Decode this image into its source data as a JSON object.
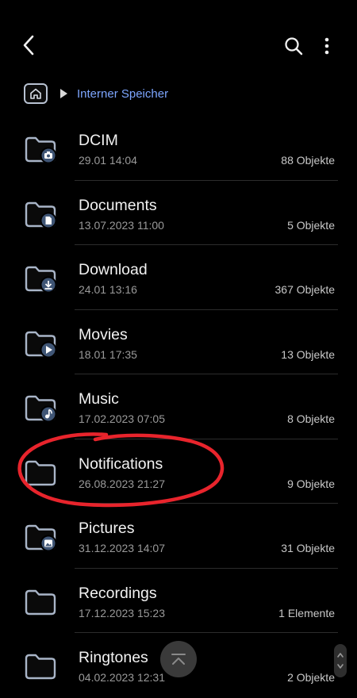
{
  "toolbar": {
    "back_icon": "chevron-left-icon",
    "search_icon": "search-icon",
    "more_icon": "more-vertical-icon"
  },
  "breadcrumb": {
    "home_icon": "home-icon",
    "label": "Interner Speicher",
    "accent": "#7da6ff"
  },
  "folders": [
    {
      "name": "DCIM",
      "date": "29.01 14:04",
      "count": "88 Objekte",
      "badge": "camera"
    },
    {
      "name": "Documents",
      "date": "13.07.2023 11:00",
      "count": "5 Objekte",
      "badge": "document"
    },
    {
      "name": "Download",
      "date": "24.01 13:16",
      "count": "367 Objekte",
      "badge": "download"
    },
    {
      "name": "Movies",
      "date": "18.01 17:35",
      "count": "13 Objekte",
      "badge": "play"
    },
    {
      "name": "Music",
      "date": "17.02.2023 07:05",
      "count": "8 Objekte",
      "badge": "music"
    },
    {
      "name": "Notifications",
      "date": "26.08.2023 21:27",
      "count": "9 Objekte",
      "badge": ""
    },
    {
      "name": "Pictures",
      "date": "31.12.2023 14:07",
      "count": "31 Objekte",
      "badge": "image"
    },
    {
      "name": "Recordings",
      "date": "17.12.2023 15:23",
      "count": "1 Elemente",
      "badge": ""
    },
    {
      "name": "Ringtones",
      "date": "04.02.2023 12:31",
      "count": "2 Objekte",
      "badge": ""
    }
  ],
  "annotation": {
    "color": "#e8242c"
  },
  "controls": {
    "scroll_top_icon": "scroll-to-top-icon",
    "scrollbar_icon": "scrollbar-handle-icon"
  }
}
